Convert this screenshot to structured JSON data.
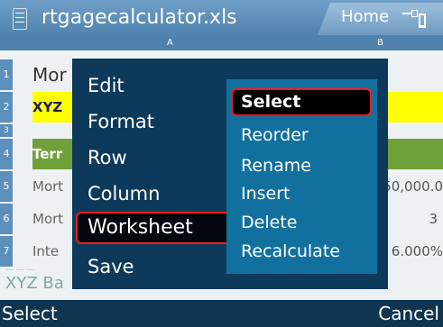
{
  "window": {
    "title": "rtgagecalculator.xls",
    "home_label": "Home"
  },
  "sheet": {
    "columns": [
      "A",
      "B"
    ],
    "rows": [
      {
        "num": "1",
        "a": "Mor",
        "b": ""
      },
      {
        "num": "2",
        "a": "XYZ",
        "b": ""
      },
      {
        "num": "3",
        "a": "",
        "b": ""
      },
      {
        "num": "4",
        "a": "Terr",
        "b": ""
      },
      {
        "num": "5",
        "a": "Mort",
        "b": "50,000.0"
      },
      {
        "num": "6",
        "a": "Mort",
        "b": "3"
      },
      {
        "num": "7",
        "a": "Inte",
        "b": "6.000%"
      }
    ],
    "footer_text": "XYZ Ba"
  },
  "menu": {
    "items": [
      "Edit",
      "Format",
      "Row",
      "Column",
      "Worksheet",
      "Save"
    ],
    "selected": "Worksheet"
  },
  "submenu": {
    "items": [
      "Select",
      "Reorder",
      "Rename",
      "Insert",
      "Delete",
      "Recalculate"
    ],
    "selected": "Select"
  },
  "softkeys": {
    "left": "Select",
    "right": "Cancel"
  },
  "colors": {
    "titlebar": "#4f81ad",
    "menu_bg": "#0d3a5b",
    "submenu_bg": "#12709e",
    "highlight_border": "#ff1a1a",
    "row2_fill": "#ffff00",
    "row4_fill": "#6fa03a"
  }
}
